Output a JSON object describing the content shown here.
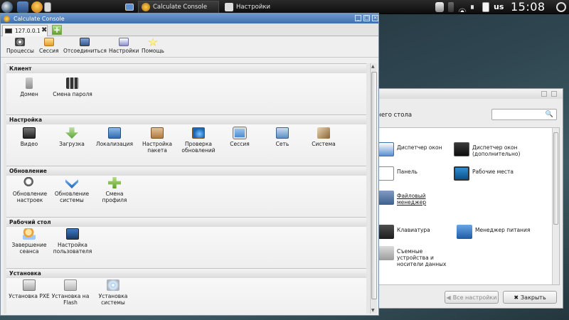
{
  "taskbar": {
    "tasks": [
      {
        "label": ""
      },
      {
        "label": "Calculate Console"
      },
      {
        "label": "Настройки"
      }
    ],
    "layout": "us",
    "clock": "15:08"
  },
  "settings_window": {
    "subtitle": "чего стола",
    "search_placeholder": "",
    "items": [
      {
        "label": "Диспетчер окон",
        "icon": "window-manager-icon"
      },
      {
        "label": "Диспетчер окон (дополнительно)",
        "icon": "window-manager-advanced-icon"
      },
      {
        "label": "Панель",
        "icon": "panel-icon"
      },
      {
        "label": "Рабочие места",
        "icon": "workspaces-icon"
      },
      {
        "label": "Файловый менеджер",
        "icon": "file-manager-icon"
      },
      {
        "label": "Клавиатура",
        "icon": "keyboard-icon"
      },
      {
        "label": "Менеджер питания",
        "icon": "power-manager-icon"
      },
      {
        "label": "Съемные устройства и носители данных",
        "icon": "removable-media-icon"
      }
    ],
    "all_settings_button": "Все настройки",
    "close_button": "Закрыть"
  },
  "main_window": {
    "title": "Calculate Console",
    "tab_label": "127.0.0.1",
    "toolbar": [
      {
        "label": "Процессы",
        "icon": "processes-icon"
      },
      {
        "label": "Сессия",
        "icon": "session-icon"
      },
      {
        "label": "Отсоединиться",
        "icon": "disconnect-icon"
      },
      {
        "label": "Настройки",
        "icon": "settings-icon"
      },
      {
        "label": "Помощь",
        "icon": "help-icon"
      }
    ],
    "sections": [
      {
        "title": "Клиент",
        "items": [
          {
            "label": "Домен",
            "icon": "domain-icon"
          },
          {
            "label": "Смена пароля",
            "icon": "password-change-icon"
          }
        ]
      },
      {
        "title": "Настройка",
        "items": [
          {
            "label": "Видео",
            "icon": "video-icon"
          },
          {
            "label": "Загрузка",
            "icon": "boot-icon"
          },
          {
            "label": "Локализация",
            "icon": "localization-icon"
          },
          {
            "label": "Настройка пакета",
            "icon": "package-settings-icon"
          },
          {
            "label": "Проверка обновлений",
            "icon": "update-check-icon"
          },
          {
            "label": "Сессия",
            "icon": "session-icon"
          },
          {
            "label": "Сеть",
            "icon": "network-icon"
          },
          {
            "label": "Система",
            "icon": "system-icon"
          }
        ]
      },
      {
        "title": "Обновление",
        "items": [
          {
            "label": "Обновление настроек",
            "icon": "update-settings-icon"
          },
          {
            "label": "Обновление системы",
            "icon": "system-update-icon"
          },
          {
            "label": "Смена профиля",
            "icon": "profile-change-icon"
          }
        ]
      },
      {
        "title": "Рабочий стол",
        "items": [
          {
            "label": "Завершение сеанса",
            "icon": "logout-icon"
          },
          {
            "label": "Настройка пользователя",
            "icon": "user-settings-icon"
          }
        ]
      },
      {
        "title": "Установка",
        "items": [
          {
            "label": "Установка PXE",
            "icon": "pxe-install-icon"
          },
          {
            "label": "Установка на Flash",
            "icon": "flash-install-icon"
          },
          {
            "label": "Установка системы",
            "icon": "system-install-icon"
          }
        ]
      }
    ]
  }
}
